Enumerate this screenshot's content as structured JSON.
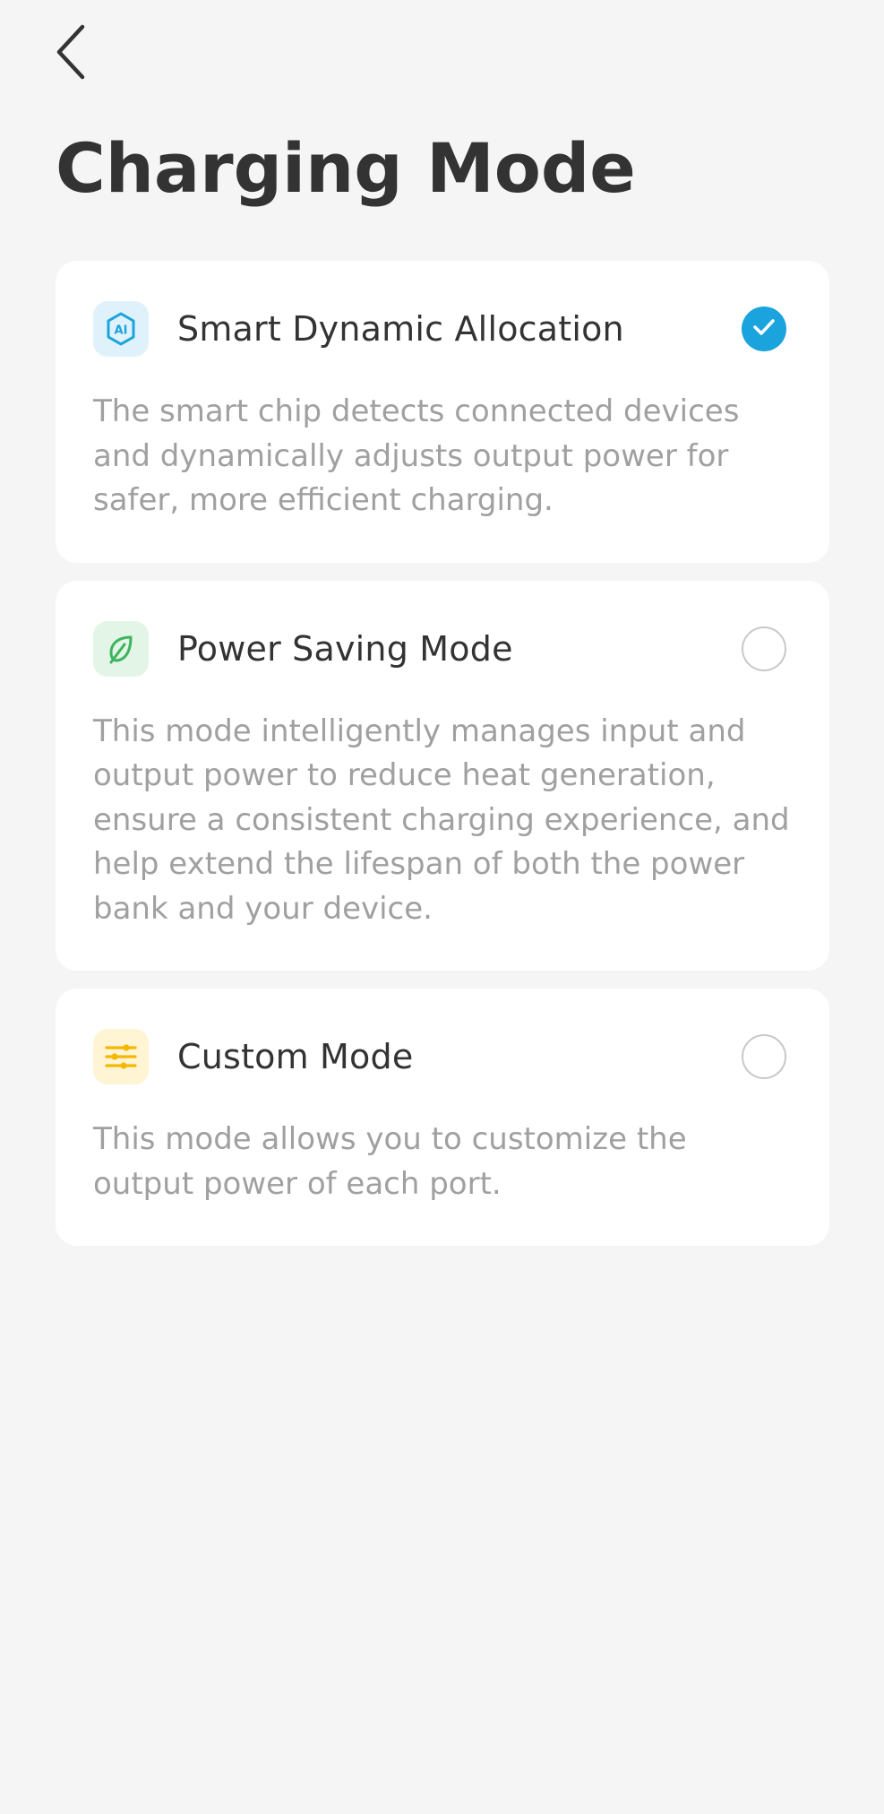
{
  "header": {
    "back_icon": "chevron-left-icon",
    "title": "Charging Mode"
  },
  "modes": [
    {
      "title": "Smart Dynamic Allocation",
      "description": "The smart chip detects connected devices and dynamically adjusts output power for safer, more efficient charging.",
      "icon": "ai-chip-icon",
      "icon_text": "AI",
      "icon_color": "#1aa3dc",
      "icon_bg": "#dff2fb",
      "selected": true
    },
    {
      "title": "Power Saving Mode",
      "description": "This mode intelligently manages input and output power to reduce heat generation, ensure a consistent charging experience, and help extend the lifespan of both the power bank and your device.",
      "icon": "leaf-icon",
      "icon_color": "#3cb55f",
      "icon_bg": "#e2f5e6",
      "selected": false
    },
    {
      "title": "Custom Mode",
      "description": "This mode allows you to customize the output power of each port.",
      "icon": "sliders-icon",
      "icon_color": "#f5b800",
      "icon_bg": "#fff4d3",
      "selected": false
    }
  ],
  "colors": {
    "background": "#f5f5f5",
    "card": "#ffffff",
    "accent": "#1aa3dc",
    "title_text": "#333333",
    "description_text": "#a0a0a0"
  }
}
